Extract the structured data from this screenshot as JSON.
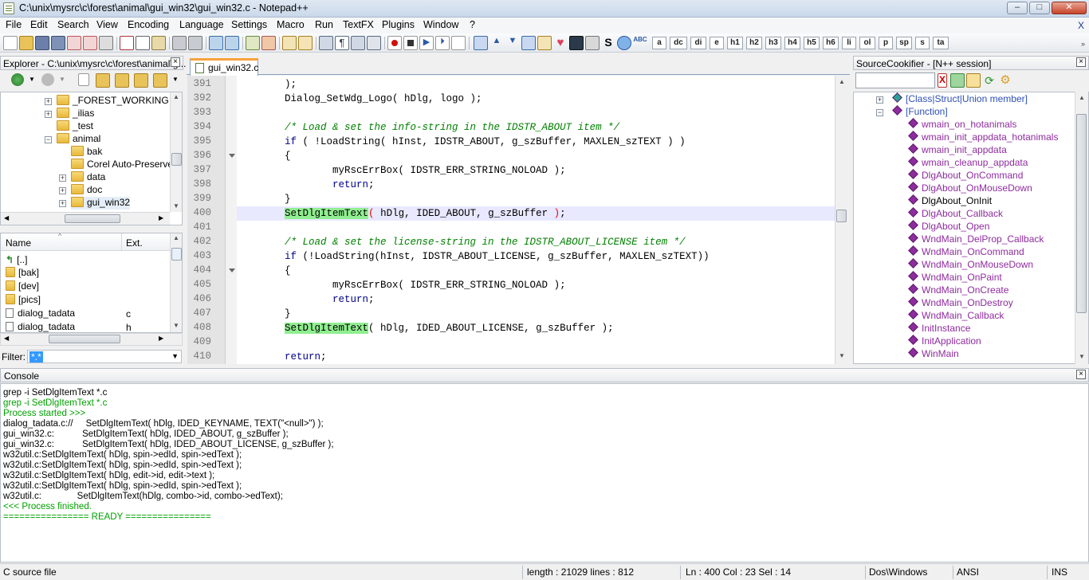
{
  "window": {
    "title": "C:\\unix\\mysrc\\c\\forest\\animal\\gui_win32\\gui_win32.c - Notepad++",
    "minimize": "–",
    "maximize": "□",
    "close": "✕"
  },
  "menu": {
    "items": [
      "File",
      "Edit",
      "Search",
      "View",
      "Encoding",
      "Language",
      "Settings",
      "Macro",
      "Run",
      "TextFX",
      "Plugins",
      "Window",
      "?"
    ],
    "right_close": "X"
  },
  "toolbar": {
    "text_buttons": [
      "a",
      "dc",
      "di",
      "e",
      "h1",
      "h2",
      "h3",
      "h4",
      "h5",
      "h6",
      "li",
      "ol",
      "p",
      "sp",
      "s",
      "ta"
    ],
    "bold_s": "S"
  },
  "explorer": {
    "title": "Explorer - C:\\unix\\mysrc\\c\\forest\\animal\\g...",
    "tree": [
      "_FOREST_WORKING",
      "_ilias",
      "_test",
      "animal",
      "bak",
      "Corel Auto-Preserve",
      "data",
      "doc",
      "gui_win32"
    ],
    "columns": {
      "name": "Name",
      "ext": "Ext."
    },
    "files": [
      {
        "name": "[..]",
        "ext": ""
      },
      {
        "name": "[bak]",
        "ext": ""
      },
      {
        "name": "[dev]",
        "ext": ""
      },
      {
        "name": "[pics]",
        "ext": ""
      },
      {
        "name": "dialog_tadata",
        "ext": "c"
      },
      {
        "name": "dialog_tadata",
        "ext": "h"
      }
    ],
    "filter_label": "Filter:",
    "filter_value": "*.*"
  },
  "editor": {
    "tab": "gui_win32.c",
    "lines": [
      {
        "n": "391",
        "segs": [
          {
            "t": "        );",
            "c": ""
          }
        ]
      },
      {
        "n": "392",
        "segs": [
          {
            "t": "        Dialog_SetWdg_Logo( hDlg, logo );",
            "c": ""
          }
        ]
      },
      {
        "n": "393",
        "segs": [
          {
            "t": "",
            "c": ""
          }
        ]
      },
      {
        "n": "394",
        "segs": [
          {
            "t": "        /* Load & set the info-string in the IDSTR_ABOUT item */",
            "c": "cm"
          }
        ]
      },
      {
        "n": "395",
        "segs": [
          {
            "t": "        if",
            "c": "kw"
          },
          {
            "t": " ( !LoadString( hInst, IDSTR_ABOUT, g_szBuffer, MAXLEN_szTEXT ) )",
            "c": ""
          }
        ]
      },
      {
        "n": "396",
        "segs": [
          {
            "t": "        {",
            "c": ""
          }
        ]
      },
      {
        "n": "397",
        "segs": [
          {
            "t": "                myRscErrBox( IDSTR_ERR_STRING_NOLOAD );",
            "c": ""
          }
        ]
      },
      {
        "n": "398",
        "segs": [
          {
            "t": "                ",
            "c": ""
          },
          {
            "t": "return",
            "c": "kw"
          },
          {
            "t": ";",
            "c": ""
          }
        ]
      },
      {
        "n": "399",
        "segs": [
          {
            "t": "        }",
            "c": ""
          }
        ]
      },
      {
        "n": "400",
        "segs": [
          {
            "t": "        ",
            "c": ""
          },
          {
            "t": "SetDlgItemText",
            "c": "hl"
          },
          {
            "t": "(",
            "c": "paren"
          },
          {
            "t": " hDlg, IDED_ABOUT, g_szBuffer ",
            "c": ""
          },
          {
            "t": ")",
            "c": "paren"
          },
          {
            "t": ";",
            "c": ""
          }
        ]
      },
      {
        "n": "401",
        "segs": [
          {
            "t": "",
            "c": ""
          }
        ]
      },
      {
        "n": "402",
        "segs": [
          {
            "t": "        /* Load & set the license-string in the IDSTR_ABOUT_LICENSE item */",
            "c": "cm"
          }
        ]
      },
      {
        "n": "403",
        "segs": [
          {
            "t": "        if",
            "c": "kw"
          },
          {
            "t": " (!LoadString(hInst, IDSTR_ABOUT_LICENSE, g_szBuffer, MAXLEN_szTEXT))",
            "c": ""
          }
        ]
      },
      {
        "n": "404",
        "segs": [
          {
            "t": "        {",
            "c": ""
          }
        ]
      },
      {
        "n": "405",
        "segs": [
          {
            "t": "                myRscErrBox( IDSTR_ERR_STRING_NOLOAD );",
            "c": ""
          }
        ]
      },
      {
        "n": "406",
        "segs": [
          {
            "t": "                ",
            "c": ""
          },
          {
            "t": "return",
            "c": "kw"
          },
          {
            "t": ";",
            "c": ""
          }
        ]
      },
      {
        "n": "407",
        "segs": [
          {
            "t": "        }",
            "c": ""
          }
        ]
      },
      {
        "n": "408",
        "segs": [
          {
            "t": "        ",
            "c": ""
          },
          {
            "t": "SetDlgItemText",
            "c": "hl"
          },
          {
            "t": "( hDlg, IDED_ABOUT_LICENSE, g_szBuffer );",
            "c": ""
          }
        ]
      },
      {
        "n": "409",
        "segs": [
          {
            "t": "",
            "c": ""
          }
        ]
      },
      {
        "n": "410",
        "segs": [
          {
            "t": "        ",
            "c": ""
          },
          {
            "t": "return",
            "c": "kw"
          },
          {
            "t": ";",
            "c": ""
          }
        ]
      }
    ]
  },
  "sourcecookifier": {
    "title": "SourceCookifier - [N++ session]",
    "groups": [
      "[Class|Struct|Union member]",
      "[Function]"
    ],
    "functions": [
      "wmain_on_hotanimals",
      "wmain_init_appdata_hotanimals",
      "wmain_init_appdata",
      "wmain_cleanup_appdata",
      "DlgAbout_OnCommand",
      "DlgAbout_OnMouseDown",
      "DlgAbout_OnInit",
      "DlgAbout_Callback",
      "DlgAbout_Open",
      "WndMain_DelProp_Callback",
      "WndMain_OnCommand",
      "WndMain_OnMouseDown",
      "WndMain_OnPaint",
      "WndMain_OnCreate",
      "WndMain_OnDestroy",
      "WndMain_Callback",
      "InitInstance",
      "InitApplication",
      "WinMain"
    ]
  },
  "console": {
    "title": "Console",
    "lines": [
      {
        "t": "grep -i SetDlgItemText *.c",
        "g": false
      },
      {
        "t": "grep -i SetDlgItemText *.c",
        "g": true
      },
      {
        "t": "Process started >>>",
        "g": true
      },
      {
        "t": "dialog_tadata.c://     SetDlgItemText( hDlg, IDED_KEYNAME, TEXT(\"<null>\") );",
        "g": false
      },
      {
        "t": "gui_win32.c:           SetDlgItemText( hDlg, IDED_ABOUT, g_szBuffer );",
        "g": false
      },
      {
        "t": "gui_win32.c:           SetDlgItemText( hDlg, IDED_ABOUT_LICENSE, g_szBuffer );",
        "g": false
      },
      {
        "t": "w32util.c:SetDlgItemText( hDlg, spin->edId, spin->edText );",
        "g": false
      },
      {
        "t": "w32util.c:SetDlgItemText( hDlg, spin->edId, spin->edText );",
        "g": false
      },
      {
        "t": "w32util.c:SetDlgItemText( hDlg, edit->id, edit->text );",
        "g": false
      },
      {
        "t": "w32util.c:SetDlgItemText( hDlg, spin->edId, spin->edText );",
        "g": false
      },
      {
        "t": "w32util.c:              SetDlgItemText(hDlg, combo->id, combo->edText);",
        "g": false
      },
      {
        "t": "<<< Process finished.",
        "g": true
      },
      {
        "t": "================ READY ================",
        "g": true
      }
    ]
  },
  "status": {
    "type": "C source file",
    "length": "length : 21029    lines : 812",
    "pos": "Ln : 400    Col : 23    Sel : 14",
    "eol": "Dos\\Windows",
    "enc": "ANSI",
    "mode": "INS"
  }
}
